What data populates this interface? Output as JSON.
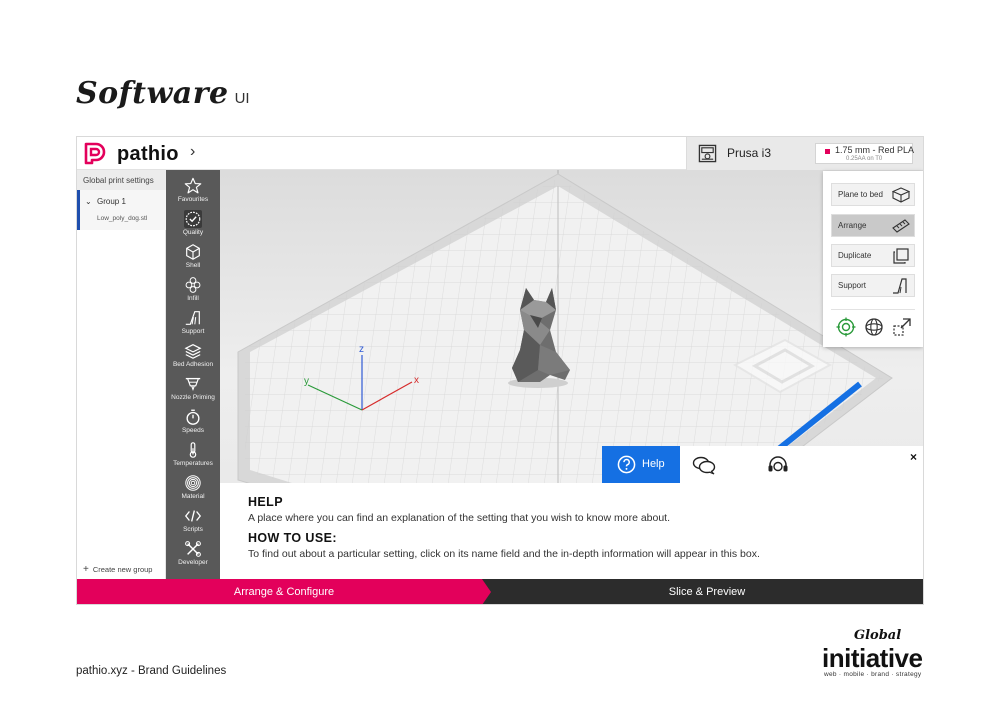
{
  "page": {
    "heading": "Software",
    "heading_sub": "UI",
    "footer": "pathio.xyz - Brand Guidelines",
    "org_logo": {
      "top": "Global",
      "main": "initiative",
      "tagline": "web · mobile · brand · strategy"
    }
  },
  "topbar": {
    "brand": "pathio",
    "brand_chevron": "›",
    "printer_name": "Prusa i3",
    "filament_main": "1.75 mm - Red PLA",
    "filament_sub": "0.25AA on T0",
    "filament_color": "#e3005b"
  },
  "left_panel": {
    "title": "Global print settings",
    "group_chevron": "⌄",
    "group_name": "Group 1",
    "file_name": "Low_poly_dog.stl",
    "create_plus": "+",
    "create_label": "Create new group"
  },
  "sidebar": {
    "items": [
      {
        "label": "Favourites",
        "icon": "star-icon"
      },
      {
        "label": "Quality",
        "icon": "quality-gauge-icon",
        "active": true
      },
      {
        "label": "Shell",
        "icon": "cube-icon"
      },
      {
        "label": "Infill",
        "icon": "hexagon-infill-icon"
      },
      {
        "label": "Support",
        "icon": "support-icon"
      },
      {
        "label": "Bed Adhesion",
        "icon": "layers-icon"
      },
      {
        "label": "Nozzle Priming",
        "icon": "nozzle-icon"
      },
      {
        "label": "Speeds",
        "icon": "stopwatch-icon"
      },
      {
        "label": "Temperatures",
        "icon": "thermometer-icon"
      },
      {
        "label": "Material",
        "icon": "spool-icon"
      },
      {
        "label": "Scripts",
        "icon": "code-icon"
      },
      {
        "label": "Developer",
        "icon": "tools-icon"
      }
    ]
  },
  "viewport": {
    "axis_z": "z",
    "axis_y": "y",
    "axis_x": "x"
  },
  "actions": {
    "plane_to_bed": "Plane to bed",
    "arrange": "Arrange",
    "duplicate": "Duplicate",
    "support": "Support"
  },
  "help": {
    "tab_help": "Help",
    "close": "×",
    "heading1": "HELP",
    "text1": "A place where you can find an explanation of the setting that you wish to know more about.",
    "heading2": "HOW TO USE:",
    "text2": "To find out about a particular setting, click on its name field and the in-depth information will appear in this box."
  },
  "stages": {
    "arrange_configure": "Arrange & Configure",
    "slice_preview": "Slice & Preview"
  },
  "colors": {
    "brand": "#e3005b",
    "accent_blue": "#1570e3",
    "sidebar": "#595959"
  }
}
